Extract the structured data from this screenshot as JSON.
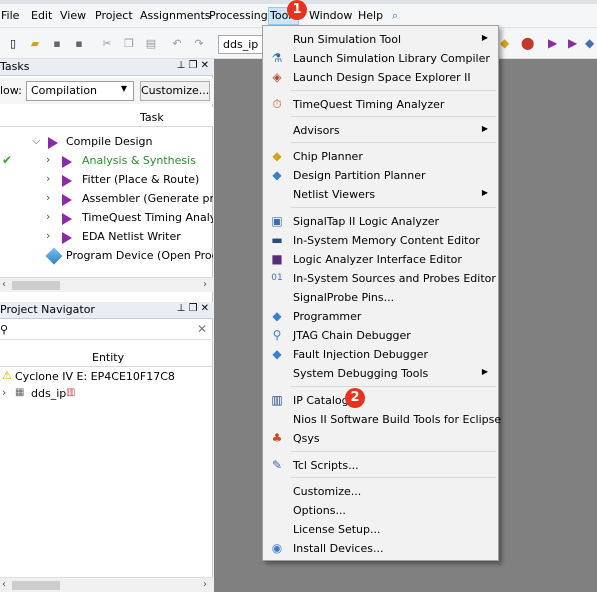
{
  "menubar": {
    "items": [
      "File",
      "Edit",
      "View",
      "Project",
      "Assignments",
      "Processing",
      "Tools",
      "Window",
      "Help"
    ]
  },
  "toolbar": {
    "project_combo": "dds_ip"
  },
  "tasks_panel": {
    "title": "Tasks",
    "flow_label": "low:",
    "flow_value": "Compilation",
    "customize_button": "Customize...",
    "column_header": "Task",
    "rows": [
      {
        "label": "Compile Design",
        "status": ""
      },
      {
        "label": "Analysis & Synthesis",
        "status": "done"
      },
      {
        "label": "Fitter (Place & Route)",
        "status": ""
      },
      {
        "label": "Assembler (Generate progra",
        "status": ""
      },
      {
        "label": "TimeQuest Timing Analysis",
        "status": ""
      },
      {
        "label": "EDA Netlist Writer",
        "status": ""
      },
      {
        "label": "Program Device (Open Program",
        "status": ""
      }
    ]
  },
  "navigator_panel": {
    "title": "Project Navigator",
    "column_header": "Entity",
    "device": "Cyclone IV E: EP4CE10F17C8",
    "entity": "dds_ip"
  },
  "tools_menu": {
    "items": [
      "Run Simulation Tool",
      "Launch Simulation Library Compiler",
      "Launch Design Space Explorer II",
      "TimeQuest Timing Analyzer",
      "Advisors",
      "Chip Planner",
      "Design Partition Planner",
      "Netlist Viewers",
      "SignalTap II Logic Analyzer",
      "In-System Memory Content Editor",
      "Logic Analyzer Interface Editor",
      "In-System Sources and Probes Editor",
      "SignalProbe Pins...",
      "Programmer",
      "JTAG Chain Debugger",
      "Fault Injection Debugger",
      "System Debugging Tools",
      "IP Catalog",
      "Nios II Software Build Tools for Eclipse",
      "Qsys",
      "Tcl Scripts...",
      "Customize...",
      "Options...",
      "License Setup...",
      "Install Devices..."
    ]
  },
  "callouts": [
    "1",
    "2"
  ],
  "colors": {
    "callout": "#e8331c",
    "menu_highlight": "#cde6f7",
    "workspace": "#808080",
    "task_play": "#8b2aa8",
    "done_text": "#2e8b2e"
  }
}
